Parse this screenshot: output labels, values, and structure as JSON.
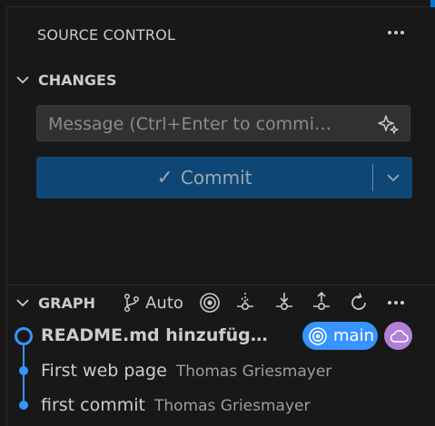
{
  "header": {
    "title": "SOURCE CONTROL",
    "more_icon": "ellipsis-icon"
  },
  "changes": {
    "label": "CHANGES",
    "message_placeholder": "Message (Ctrl+Enter to commi…",
    "message_value": "",
    "commit_label": "Commit",
    "commit_icon": "check-icon"
  },
  "graph": {
    "label": "GRAPH",
    "auto_label": "Auto",
    "toolbar_icons": [
      "branch-icon",
      "target-icon",
      "fetch-icon",
      "pull-icon",
      "push-icon",
      "refresh-icon",
      "ellipsis-icon"
    ],
    "commits": [
      {
        "message": "README.md hinzufüg…",
        "author": "",
        "bold": true
      },
      {
        "message": "First web page",
        "author": "Thomas Griesmayer",
        "bold": false
      },
      {
        "message": "first commit",
        "author": "Thomas Griesmayer",
        "bold": false
      }
    ],
    "branch_badge": "main",
    "colors": {
      "graph_line": "#3794ff",
      "branch_badge": "#3794ff",
      "remote_badge": "#b180d7",
      "commit_button": "#0e4775"
    }
  }
}
